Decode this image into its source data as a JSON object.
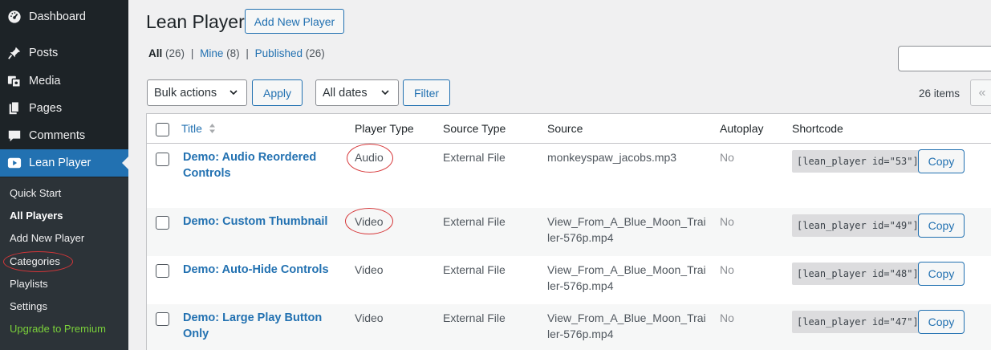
{
  "sidebar": {
    "items": [
      {
        "label": "Dashboard",
        "icon": "dashboard-icon"
      },
      {
        "label": "Posts",
        "icon": "pin-icon"
      },
      {
        "label": "Media",
        "icon": "media-icon"
      },
      {
        "label": "Pages",
        "icon": "pages-icon"
      },
      {
        "label": "Comments",
        "icon": "comment-icon"
      },
      {
        "label": "Lean Player",
        "icon": "play-icon"
      }
    ],
    "submenu": [
      "Quick Start",
      "All Players",
      "Add New Player",
      "Categories",
      "Playlists",
      "Settings",
      "Upgrade to Premium"
    ]
  },
  "header": {
    "title": "Lean Player",
    "add_new": "Add New Player"
  },
  "views": {
    "all": "All",
    "all_count": "(26)",
    "mine": "Mine",
    "mine_count": "(8)",
    "published": "Published",
    "published_count": "(26)",
    "sep": "|"
  },
  "toolbar": {
    "bulk_actions": "Bulk actions",
    "apply": "Apply",
    "dates": "All dates",
    "filter": "Filter",
    "items": "26 items",
    "first_page": "«"
  },
  "table": {
    "headers": [
      "Title",
      "Player Type",
      "Source Type",
      "Source",
      "Autoplay",
      "Shortcode"
    ],
    "rows": [
      {
        "title": "Demo: Audio Reordered Controls",
        "type": "Audio",
        "source_type": "External File",
        "source": "monkeyspaw_jacobs.mp3",
        "autoplay": "No",
        "shortcode": "[lean_player id=\"53\"]",
        "copy": "Copy"
      },
      {
        "title": "Demo: Custom Thumbnail",
        "type": "Video",
        "source_type": "External File",
        "source": "View_From_A_Blue_Moon_Trailer-576p.mp4",
        "autoplay": "No",
        "shortcode": "[lean_player id=\"49\"]",
        "copy": "Copy"
      },
      {
        "title": "Demo: Auto-Hide Controls",
        "type": "Video",
        "source_type": "External File",
        "source": "View_From_A_Blue_Moon_Trailer-576p.mp4",
        "autoplay": "No",
        "shortcode": "[lean_player id=\"48\"]",
        "copy": "Copy"
      },
      {
        "title": "Demo: Large Play Button Only",
        "type": "Video",
        "source_type": "External File",
        "source": "View_From_A_Blue_Moon_Trailer-576p.mp4",
        "autoplay": "No",
        "shortcode": "[lean_player id=\"47\"]",
        "copy": "Copy"
      }
    ]
  },
  "colors": {
    "accent": "#2271b1",
    "sidebar_bg": "#1d2327",
    "annotation_ring": "#d63638",
    "premium": "#7ad03a"
  }
}
